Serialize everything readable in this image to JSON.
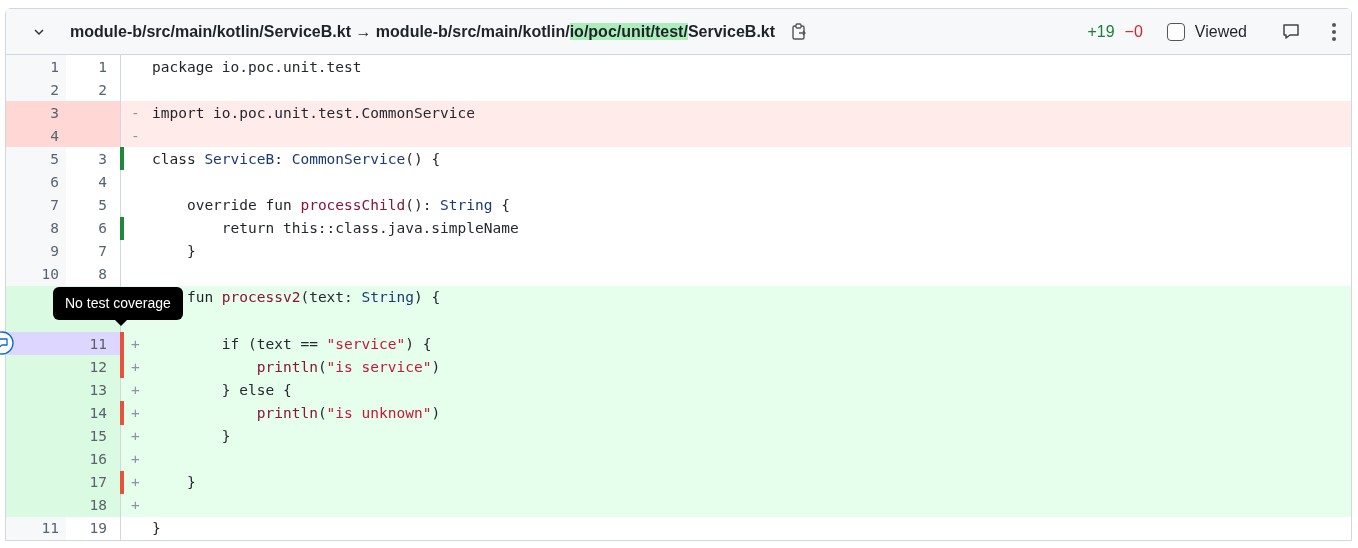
{
  "header": {
    "expanded": true,
    "path": [
      {
        "text": "module-b/src/main/kotlin/ServiceB.kt → module-b/src/main/kotlin/",
        "highlight": false
      },
      {
        "text": "io/poc/unit/test/",
        "highlight": true
      },
      {
        "text": "ServiceB.kt",
        "highlight": false
      }
    ],
    "additions": "+19",
    "deletions": "−0",
    "viewed": {
      "label": "Viewed",
      "checked": false
    }
  },
  "lines": [
    {
      "old": "1",
      "new": "1",
      "kind": "context",
      "selected": false,
      "tokens": [
        {
          "t": "package",
          "kind": "keyword"
        },
        {
          "t": " io.poc.unit.test",
          "kind": "plain"
        }
      ]
    },
    {
      "old": "2",
      "new": "2",
      "kind": "context",
      "selected": false
    },
    {
      "old": "3",
      "kind": "deleted",
      "marker": "-",
      "selected": false,
      "tokens": [
        {
          "t": "import",
          "kind": "keyword"
        },
        {
          "t": " io.poc.unit.test.CommonService",
          "kind": "plain"
        }
      ]
    },
    {
      "old": "4",
      "kind": "deleted",
      "marker": "-",
      "selected": false
    },
    {
      "old": "5",
      "new": "3",
      "kind": "context",
      "covered": true,
      "selected": false,
      "tokens": [
        {
          "t": "class",
          "kind": "keyword"
        },
        {
          "t": " ServiceB",
          "kind": "type"
        },
        {
          "t": ": ",
          "kind": "plain"
        },
        {
          "t": "CommonService",
          "kind": "type"
        },
        {
          "t": "() {",
          "kind": "plain"
        }
      ]
    },
    {
      "old": "6",
      "new": "4",
      "kind": "context",
      "selected": false
    },
    {
      "old": "7",
      "new": "5",
      "kind": "context",
      "selected": false,
      "tokens": [
        {
          "t": "    override fun",
          "kind": "keyword"
        },
        {
          "t": " processChild",
          "kind": "function"
        },
        {
          "t": "(): ",
          "kind": "plain"
        },
        {
          "t": "String",
          "kind": "type"
        },
        {
          "t": " {",
          "kind": "plain"
        }
      ]
    },
    {
      "old": "8",
      "new": "6",
      "kind": "context",
      "covered": true,
      "selected": false,
      "tokens": [
        {
          "t": "        return",
          "kind": "keyword"
        },
        {
          "t": " this::class.java.simpleName",
          "kind": "plain"
        }
      ]
    },
    {
      "old": "9",
      "new": "7",
      "kind": "context",
      "selected": false,
      "tokens": [
        {
          "t": "    }",
          "kind": "plain"
        }
      ]
    },
    {
      "old": "10",
      "new": "8",
      "kind": "context",
      "selected": false
    },
    {
      "kind": "added",
      "selected": false,
      "tokens": [
        {
          "t": "    fun",
          "kind": "keyword"
        },
        {
          "t": " processv2",
          "kind": "function"
        },
        {
          "t": "(text: ",
          "kind": "plain"
        },
        {
          "t": "String",
          "kind": "type"
        },
        {
          "t": ") {",
          "kind": "plain"
        }
      ]
    },
    {
      "kind": "added",
      "selected": false
    },
    {
      "new": "11",
      "kind": "added",
      "marker": "+",
      "covered": false,
      "selected": true,
      "tooltip": "No test coverage",
      "tokens": [
        {
          "t": "        if (text == ",
          "kind": "plain"
        },
        {
          "t": "\"service\"",
          "kind": "string"
        },
        {
          "t": ") {",
          "kind": "plain"
        }
      ]
    },
    {
      "new": "12",
      "kind": "added",
      "marker": "+",
      "covered": false,
      "selected": false,
      "tokens": [
        {
          "t": "            println",
          "kind": "function"
        },
        {
          "t": "(",
          "kind": "plain"
        },
        {
          "t": "\"is service\"",
          "kind": "string"
        },
        {
          "t": ")",
          "kind": "plain"
        }
      ]
    },
    {
      "new": "13",
      "kind": "added",
      "marker": "+",
      "selected": false,
      "tokens": [
        {
          "t": "        } else {",
          "kind": "plain"
        }
      ]
    },
    {
      "new": "14",
      "kind": "added",
      "marker": "+",
      "covered": false,
      "selected": false,
      "tokens": [
        {
          "t": "            println",
          "kind": "function"
        },
        {
          "t": "(",
          "kind": "plain"
        },
        {
          "t": "\"is unknown\"",
          "kind": "string"
        },
        {
          "t": ")",
          "kind": "plain"
        }
      ]
    },
    {
      "new": "15",
      "kind": "added",
      "marker": "+",
      "selected": false,
      "tokens": [
        {
          "t": "        }",
          "kind": "plain"
        }
      ]
    },
    {
      "new": "16",
      "kind": "added",
      "marker": "+",
      "selected": false
    },
    {
      "new": "17",
      "kind": "added",
      "marker": "+",
      "covered": false,
      "selected": false,
      "tokens": [
        {
          "t": "    }",
          "kind": "plain"
        }
      ]
    },
    {
      "new": "18",
      "kind": "added",
      "marker": "+",
      "selected": false
    },
    {
      "old": "11",
      "new": "19",
      "kind": "context",
      "selected": false,
      "tokens": [
        {
          "t": "}",
          "kind": "plain"
        }
      ]
    }
  ]
}
